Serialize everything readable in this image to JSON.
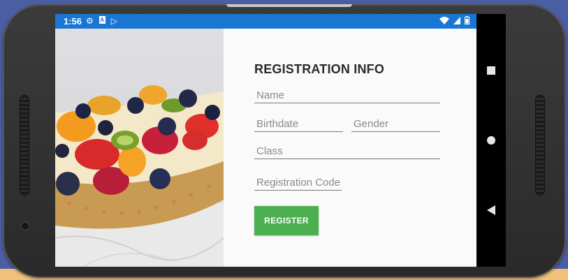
{
  "status_bar": {
    "time": "1:56",
    "left_icons": [
      "gear-icon",
      "a-icon",
      "play-store-icon"
    ],
    "right_icons": [
      "wifi-icon",
      "signal-icon",
      "battery-icon"
    ]
  },
  "form": {
    "title": "REGISTRATION INFO",
    "name_placeholder": "Name",
    "birthdate_placeholder": "Birthdate",
    "gender_placeholder": "Gender",
    "class_placeholder": "Class",
    "registration_code_placeholder": "Registration Code",
    "register_label": "REGISTER"
  },
  "colors": {
    "status_bar": "#1976d2",
    "register_button": "#4caf50",
    "form_background": "#fafafa"
  }
}
